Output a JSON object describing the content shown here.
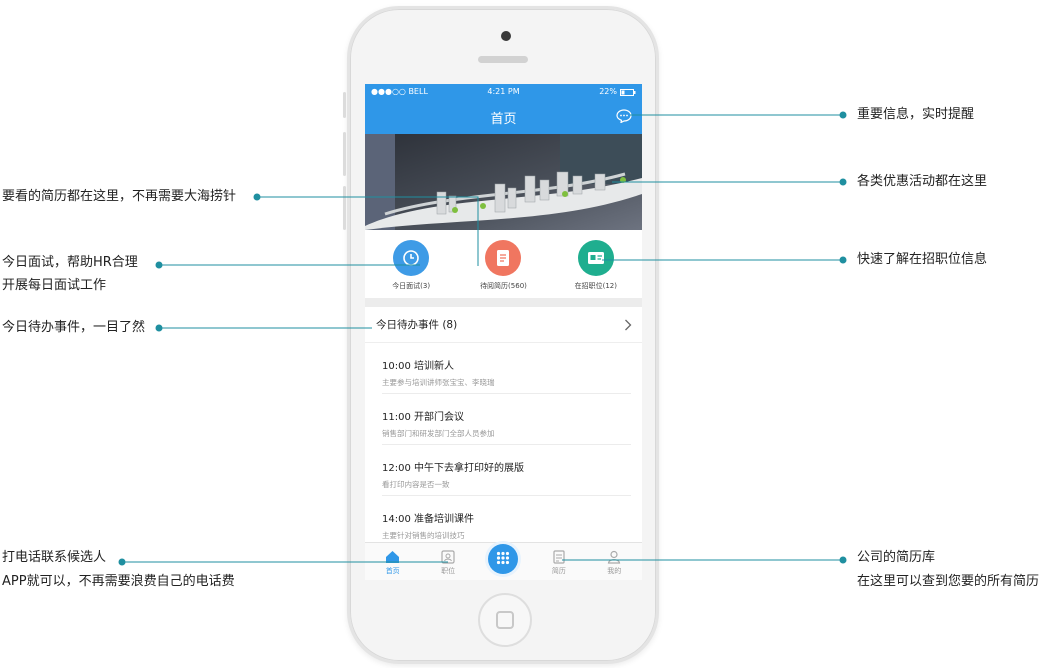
{
  "status_bar": {
    "carrier": "●●●○○ BELL",
    "time": "4:21 PM",
    "battery": "22%"
  },
  "nav": {
    "title": "首页"
  },
  "quick_actions": [
    {
      "label": "今日面试(3)",
      "color": "#3e9be6",
      "icon": "clock-icon"
    },
    {
      "label": "待阅简历(560)",
      "color": "#f07660",
      "icon": "resume-icon"
    },
    {
      "label": "在招职位(12)",
      "color": "#1fae8f",
      "icon": "job-icon"
    }
  ],
  "todo": {
    "header": "今日待办事件 (8)",
    "items": [
      {
        "title": "10:00 培训新人",
        "sub": "主要参与培训讲师张宝宝、李晓瑞"
      },
      {
        "title": "11:00 开部门会议",
        "sub": "销售部门和研发部门全部人员参加"
      },
      {
        "title": "12:00 中午下去拿打印好的展版",
        "sub": "看打印内容是否一致"
      },
      {
        "title": "14:00 准备培训课件",
        "sub": "主要针对销售的培训技巧"
      }
    ]
  },
  "tabs": [
    {
      "label": "首页"
    },
    {
      "label": "职位"
    },
    {
      "label": ""
    },
    {
      "label": "简历"
    },
    {
      "label": "我的"
    }
  ],
  "annotations": {
    "left": {
      "resumes": "要看的简历都在这里，不再需要大海捞针",
      "interview_1": "今日面试，帮助HR合理",
      "interview_2": "开展每日面试工作",
      "todo": "今日待办事件，一目了然",
      "call_1": "打电话联系候选人",
      "call_2": "APP就可以，不再需要浪费自己的电话费"
    },
    "right": {
      "important": "重要信息，实时提醒",
      "promo": "各类优惠活动都在这里",
      "jobs": "快速了解在招职位信息",
      "library_1": "公司的简历库",
      "library_2": "在这里可以查到您要的所有简历"
    }
  },
  "colors": {
    "accent": "#2f97e8",
    "leader_line": "#1f8fa0"
  }
}
